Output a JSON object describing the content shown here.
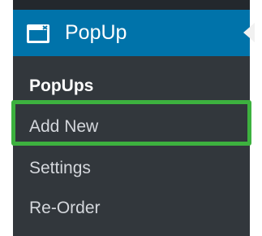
{
  "menu": {
    "title": "PopUp",
    "icon": "popup-window-icon",
    "submenu": [
      {
        "label": "PopUps",
        "active": true
      },
      {
        "label": "Add New",
        "active": false,
        "highlighted": true
      },
      {
        "label": "Settings",
        "active": false
      },
      {
        "label": "Re-Order",
        "active": false
      }
    ]
  },
  "colors": {
    "menu_background": "#23282d",
    "submenu_background": "#32373c",
    "header_background": "#0073aa",
    "highlight_border": "#3db13f",
    "text": "#d4d7dc",
    "active_text": "#ffffff"
  }
}
